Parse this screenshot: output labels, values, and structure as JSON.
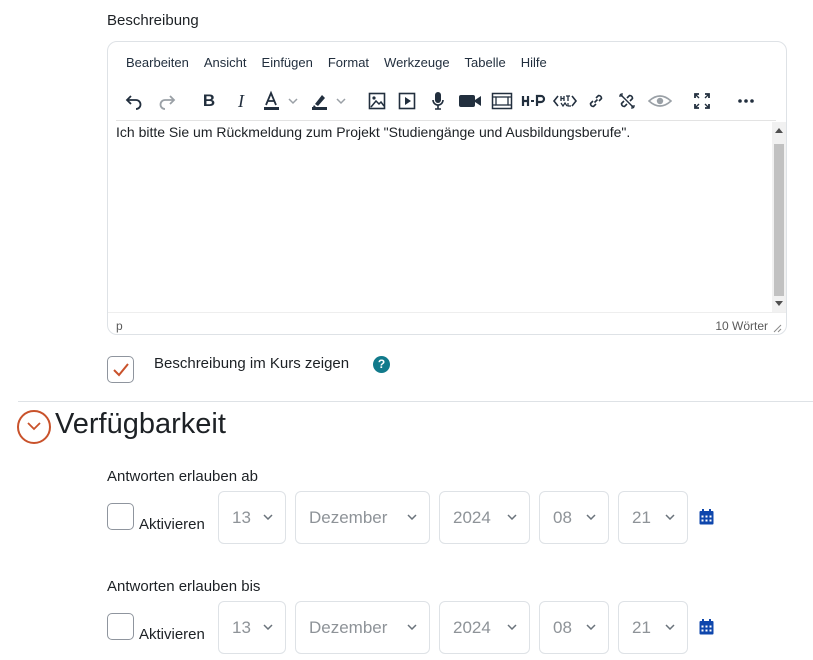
{
  "description_label": "Beschreibung",
  "editor": {
    "menu": [
      "Bearbeiten",
      "Ansicht",
      "Einfügen",
      "Format",
      "Werkzeuge",
      "Tabelle",
      "Hilfe"
    ],
    "toolbar_icons": [
      "undo-icon",
      "redo-icon",
      "bold-icon",
      "italic-icon",
      "text-color-icon",
      "highlight-color-icon",
      "image-icon",
      "media-icon",
      "record-audio-icon",
      "record-video-icon",
      "manage-files-icon",
      "h5p-icon",
      "html-icon",
      "link-icon",
      "unlink-icon",
      "preview-icon",
      "fullscreen-icon",
      "more-icon"
    ],
    "bold_glyph": "B",
    "italic_glyph": "I",
    "content": "Ich bitte Sie um Rückmeldung zum Projekt \"Studiengänge und Ausbildungsberufe\".",
    "path": "p",
    "word_count": "10 Wörter",
    "accent_color": "#222f3e"
  },
  "show_in_course": {
    "label": "Beschreibung im Kurs zeigen",
    "checked": true,
    "check_color": "#c9522b",
    "help_glyph": "?"
  },
  "availability": {
    "title": "Verfügbarkeit",
    "toggle_color": "#c9522b",
    "rows": [
      {
        "label": "Antworten erlauben ab",
        "enable_label": "Aktivieren",
        "day": "13",
        "month": "Dezember",
        "year": "2024",
        "hour": "08",
        "minute": "21"
      },
      {
        "label": "Antworten erlauben bis",
        "enable_label": "Aktivieren",
        "day": "13",
        "month": "Dezember",
        "year": "2024",
        "hour": "08",
        "minute": "21"
      }
    ],
    "calendar_color": "#0f47ad"
  }
}
